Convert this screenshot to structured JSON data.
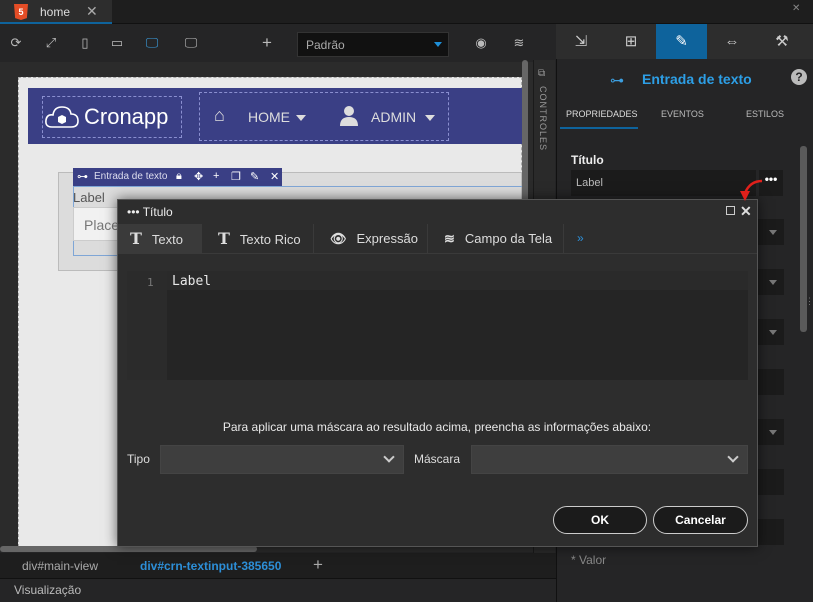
{
  "file_tab": {
    "icon": "5",
    "label": "home",
    "close": "✕"
  },
  "window": {
    "close": "✕"
  },
  "toolbar": {
    "screen_select": "Padrão",
    "plus": "+"
  },
  "right_panel": {
    "component_title": "Entrada de texto",
    "help": "?",
    "subtabs": [
      "PROPRIEDADES",
      "EVENTOS",
      "ESTILOS"
    ],
    "prop_title_label": "Título",
    "prop_title_value": "Label",
    "prop_dots": "•••",
    "valor_label": "* Valor"
  },
  "controls_strip": {
    "label": "CONTROLES"
  },
  "canvas": {
    "brand": "Cronapp",
    "nav_home": "HOME",
    "nav_admin": "ADMIN",
    "component_bar_label": "Entrada de texto",
    "component_label": "Label",
    "component_placeholder": "Place"
  },
  "breadcrumbs": {
    "item1": "div#main-view",
    "item2": "div#crn-textinput-385650",
    "plus": "+"
  },
  "status": {
    "label": "Visualização"
  },
  "dialog": {
    "title": "••• Título",
    "close": "✕",
    "tabs": [
      {
        "icon": "T",
        "label": "Texto"
      },
      {
        "icon": "T",
        "label": "Texto Rico"
      },
      {
        "icon": "👁",
        "label": "Expressão"
      },
      {
        "icon": "≋",
        "label": "Campo da Tela"
      }
    ],
    "more": "»",
    "editor": {
      "line_number": "1",
      "code": "Label"
    },
    "mask_hint": "Para aplicar uma máscara ao resultado acima, preencha as informações abaixo:",
    "tipo_label": "Tipo",
    "mascara_label": "Máscara",
    "ok_label": "OK",
    "cancel_label": "Cancelar"
  }
}
